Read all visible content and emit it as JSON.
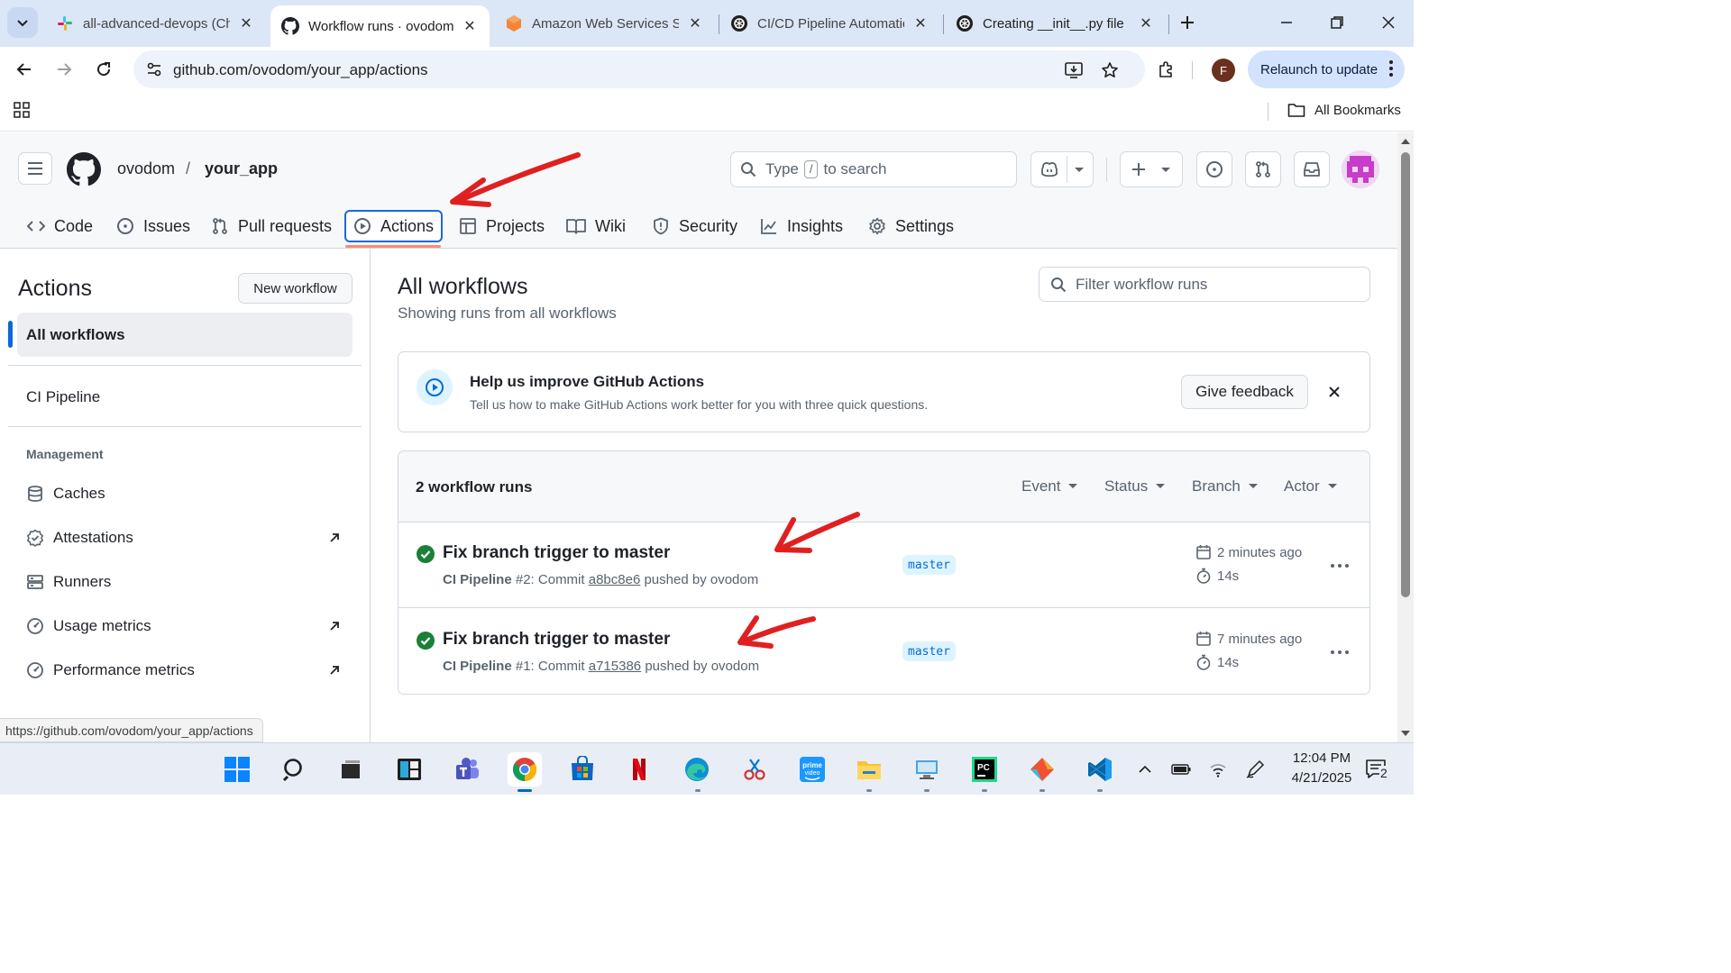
{
  "browser": {
    "tabs": [
      {
        "title": "all-advanced-devops (Ch",
        "icon": "slack-icon",
        "active": false
      },
      {
        "title": "Workflow runs · ovodom/",
        "icon": "github-icon",
        "active": true
      },
      {
        "title": "Amazon Web Services Sig",
        "icon": "aws-icon",
        "active": false
      },
      {
        "title": "CI/CD Pipeline Automatic",
        "icon": "chatgpt-icon",
        "active": false
      },
      {
        "title": "Creating __init__.py file",
        "icon": "chatgpt-icon",
        "active": false
      }
    ],
    "url": "github.com/ovodom/your_app/actions",
    "profile_initial": "F",
    "relaunch_label": "Relaunch to update",
    "all_bookmarks": "All Bookmarks",
    "status_url": "https://github.com/ovodom/your_app/actions"
  },
  "header": {
    "owner": "ovodom",
    "separator": "/",
    "repo": "your_app",
    "search_pre": "Type",
    "search_key": "/",
    "search_post": "to search"
  },
  "repo_nav": [
    {
      "label": "Code",
      "icon": "code-icon"
    },
    {
      "label": "Issues",
      "icon": "issue-icon"
    },
    {
      "label": "Pull requests",
      "icon": "pull-request-icon"
    },
    {
      "label": "Actions",
      "icon": "play-icon",
      "selected": true
    },
    {
      "label": "Projects",
      "icon": "table-icon"
    },
    {
      "label": "Wiki",
      "icon": "book-icon"
    },
    {
      "label": "Security",
      "icon": "shield-icon"
    },
    {
      "label": "Insights",
      "icon": "graph-icon"
    },
    {
      "label": "Settings",
      "icon": "gear-icon"
    }
  ],
  "sidebar": {
    "title": "Actions",
    "new_workflow": "New workflow",
    "all_workflows": "All workflows",
    "workflows": [
      "CI Pipeline"
    ],
    "management_label": "Management",
    "management": [
      {
        "label": "Caches",
        "icon": "database-icon",
        "external": false
      },
      {
        "label": "Attestations",
        "icon": "verified-icon",
        "external": true
      },
      {
        "label": "Runners",
        "icon": "server-icon",
        "external": false
      },
      {
        "label": "Usage metrics",
        "icon": "meter-icon",
        "external": true
      },
      {
        "label": "Performance metrics",
        "icon": "meter-icon",
        "external": true
      }
    ]
  },
  "main": {
    "title": "All workflows",
    "subtitle": "Showing runs from all workflows",
    "filter_placeholder": "Filter workflow runs",
    "banner": {
      "title": "Help us improve GitHub Actions",
      "text": "Tell us how to make GitHub Actions work better for you with three quick questions.",
      "button": "Give feedback"
    },
    "runs_count": "2 workflow runs",
    "filters": [
      "Event",
      "Status",
      "Branch",
      "Actor"
    ],
    "runs": [
      {
        "title": "Fix branch trigger to master",
        "workflow": "CI Pipeline",
        "number": "#2",
        "commit_label": "Commit",
        "sha": "a8bc8e6",
        "pushed_by": "pushed by ovodom",
        "branch": "master",
        "time": "2 minutes ago",
        "duration": "14s",
        "status": "success"
      },
      {
        "title": "Fix branch trigger to master",
        "workflow": "CI Pipeline",
        "number": "#1",
        "commit_label": "Commit",
        "sha": "a715386",
        "pushed_by": "pushed by ovodom",
        "branch": "master",
        "time": "7 minutes ago",
        "duration": "14s",
        "status": "success"
      }
    ]
  },
  "taskbar": {
    "apps": [
      "windows-start-icon",
      "search-icon",
      "task-view-icon",
      "widgets-icon",
      "teams-icon",
      "chrome-icon",
      "ms-store-icon",
      "netflix-icon",
      "edge-icon",
      "snipping-icon",
      "prime-video-icon",
      "file-explorer-icon",
      "remote-desktop-icon",
      "pycharm-icon",
      "git-icon",
      "vscode-icon"
    ],
    "time": "12:04 PM",
    "date": "4/21/2025",
    "notifications": "2"
  },
  "colors": {
    "success": "#1a7f37",
    "accent": "#0969da",
    "annotation": "#e02020",
    "selected_underline": "#fd8c73"
  }
}
